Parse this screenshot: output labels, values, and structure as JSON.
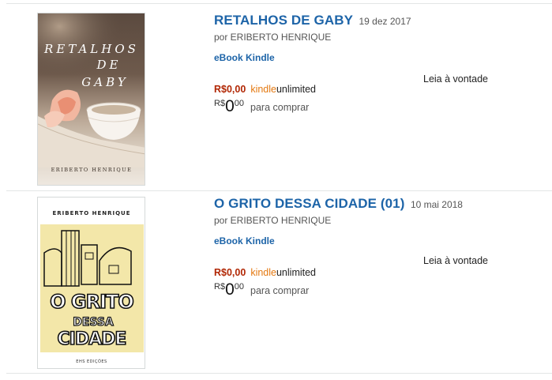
{
  "results": [
    {
      "title": "RETALHOS DE GABY",
      "date": "19 dez 2017",
      "author": "por ERIBERTO HENRIQUE",
      "format": "eBook Kindle",
      "ku_price": "R$0,00",
      "ku_kindle": "kindle",
      "ku_unlimited": "unlimited",
      "buy_currency": "R$",
      "buy_whole": "0",
      "buy_fraction": "00",
      "buy_label": "para comprar",
      "read_free": "Leia à vontade",
      "cover": {
        "title_line1": "RETALHOS",
        "title_line2": "DE",
        "title_line3": "GABY",
        "author": "ERIBERTO HENRIQUE"
      }
    },
    {
      "title": "O GRITO DESSA CIDADE (01)",
      "date": "10 mai 2018",
      "author": "por ERIBERTO HENRIQUE",
      "format": "eBook Kindle",
      "ku_price": "R$0,00",
      "ku_kindle": "kindle",
      "ku_unlimited": "unlimited",
      "buy_currency": "R$",
      "buy_whole": "0",
      "buy_fraction": "00",
      "buy_label": "para comprar",
      "read_free": "Leia à vontade",
      "cover": {
        "author": "ERIBERTO HENRIQUE",
        "word1": "O GRITO",
        "word2": "DESSA",
        "word3": "CIDADE",
        "publisher": "EHS EDIÇÕES"
      }
    }
  ]
}
